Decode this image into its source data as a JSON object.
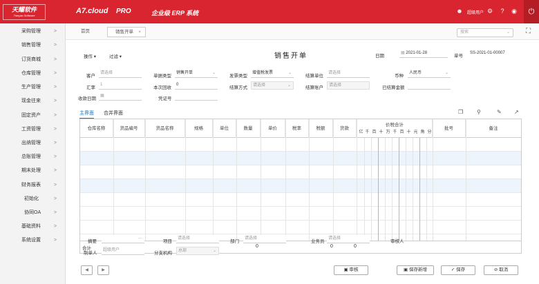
{
  "header": {
    "logo": {
      "cn": "天耀软件",
      "en": "Tianyao Software"
    },
    "brand": "A7.cloud",
    "edition": "PRO",
    "product": "企业级 ERP 系统",
    "user_label": "超级用户"
  },
  "sidebar": {
    "items": [
      "采购管理",
      "销售管理",
      "订货商城",
      "仓库管理",
      "生产管理",
      "现金往来",
      "固定资产",
      "工资管理",
      "出纳管理",
      "总账管理",
      "期末处理",
      "财务报表",
      "初始化",
      "协同OA",
      "基础资料",
      "系统设置"
    ]
  },
  "tabs": {
    "home": "首页",
    "active": "销售开单",
    "search_placeholder": "搜索"
  },
  "toolbar": {
    "operation": "操作",
    "filter": "过滤"
  },
  "form": {
    "title": "销售开单",
    "date_label": "日期",
    "date_value": "2021-01-28",
    "no_label": "单号",
    "no_value": "SS-2021-01-00007",
    "customer_label": "客户",
    "customer_ph": "请选择",
    "doctype_label": "单据类型",
    "doctype_value": "销售开单",
    "invoice_label": "发票类型",
    "invoice_value": "增值税发票",
    "settle_unit_label": "结算单位",
    "settle_unit_ph": "请选择",
    "currency_label": "币种",
    "currency_value": "人民币",
    "rate_label": "汇率",
    "rate_value": "1",
    "received_label": "本次回收",
    "received_value": "0",
    "settle_method_label": "结算方式",
    "settle_method_ph": "请选择",
    "settle_account_label": "结算账户",
    "settle_account_ph": "请选择",
    "settled_amount_label": "已结算金额",
    "receipt_date_label": "收款日期",
    "voucher_label": "凭证号"
  },
  "subtabs": {
    "main": "主界面",
    "merge": "合并界面"
  },
  "table": {
    "columns": [
      "仓库名称",
      "货品编号",
      "货品名称",
      "规格",
      "单位",
      "数量",
      "单价",
      "税率",
      "税额",
      "货款"
    ],
    "price_total": "价税合计",
    "digits": [
      "亿",
      "千",
      "百",
      "十",
      "万",
      "千",
      "百",
      "十",
      "元",
      "角",
      "分"
    ],
    "batch": "批号",
    "remark": "备注",
    "total_label": "合计",
    "total_qty": "0",
    "total_tax": "0",
    "total_goods": "0"
  },
  "footer_form": {
    "summary_label": "摘要",
    "summary_more": "···",
    "project_label": "项目",
    "project_ph": "请选择",
    "dept_label": "部门",
    "dept_ph": "请选择",
    "salesman_label": "业务员",
    "salesman_ph": "请选择",
    "reviewer_label": "审核人",
    "maker_label": "制单人",
    "maker_ph": "超级用户",
    "branch_label": "分支机构",
    "branch_ph": "总部"
  },
  "buttons": {
    "audit": "审核",
    "save_new": "保存新增",
    "save": "保存",
    "cancel": "取消"
  },
  "colors": {
    "brand": "#d9252f",
    "link": "#1a73c8"
  }
}
